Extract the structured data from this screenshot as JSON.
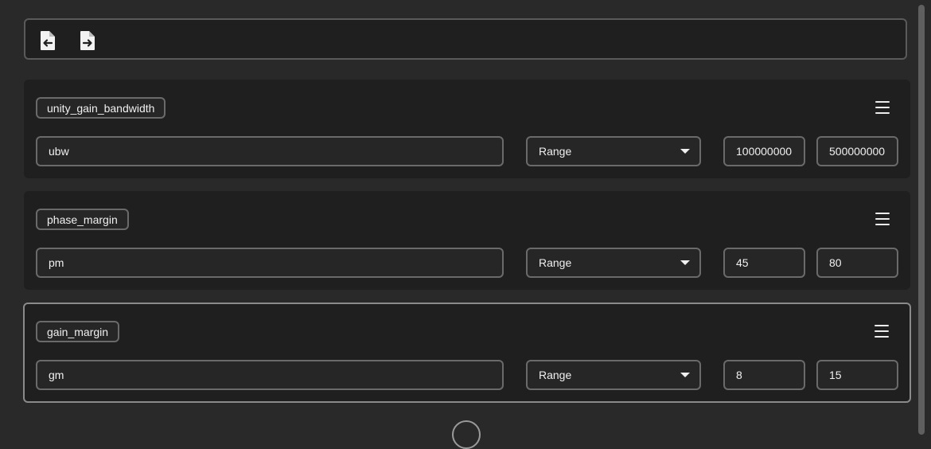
{
  "toolbar": {
    "buttons": [
      {
        "icon": "file-import-icon",
        "label": ""
      },
      {
        "icon": "file-export-icon",
        "label": ""
      }
    ]
  },
  "specs": [
    {
      "title": "unity_gain_bandwidth",
      "name": "ubw",
      "mode": "Range",
      "min": "100000000",
      "max": "500000000"
    },
    {
      "title": "phase_margin",
      "name": "pm",
      "mode": "Range",
      "min": "45",
      "max": "80"
    },
    {
      "title": "gain_margin",
      "name": "gm",
      "mode": "Range",
      "min": "8",
      "max": "15"
    }
  ],
  "colors": {
    "background": "#292929",
    "card": "#1f1f1f",
    "border": "#6a6a6a",
    "text": "#f0f0f0"
  }
}
